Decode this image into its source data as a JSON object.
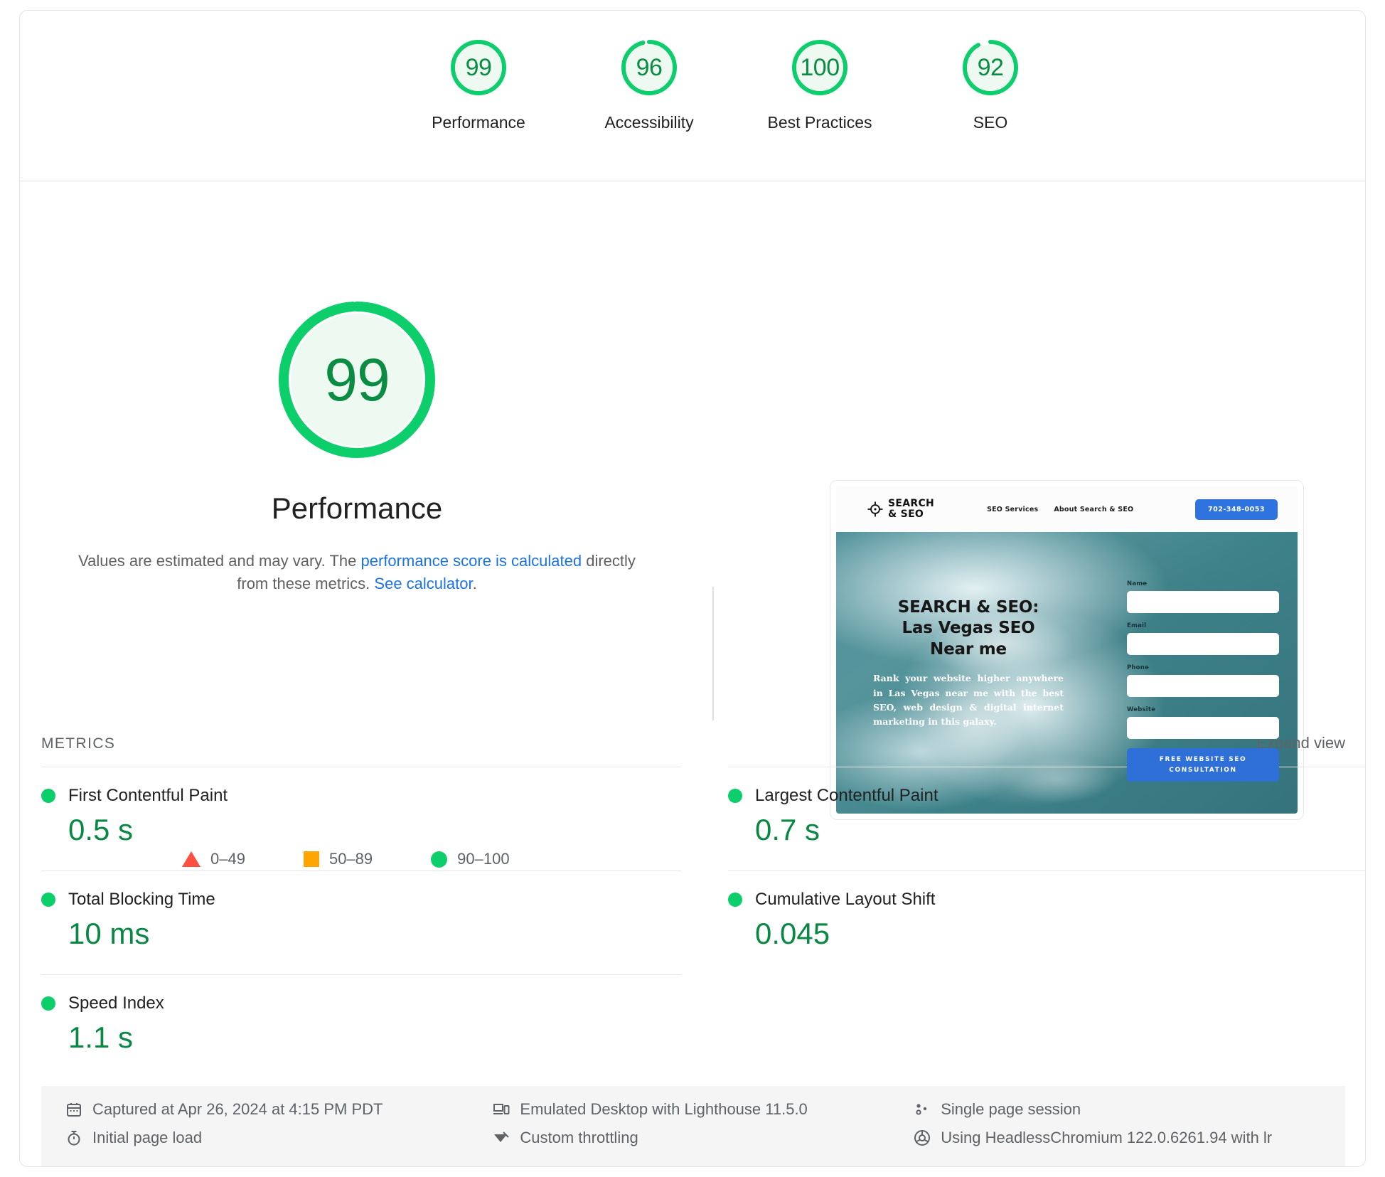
{
  "colors": {
    "green": "#0cce6b",
    "green_text": "#088842",
    "orange": "#ffa400",
    "red": "#ff4e42",
    "link": "#1a73e8",
    "gauge_fill": "#eef9f1"
  },
  "score_gauges": [
    {
      "score": 99,
      "label": "Performance"
    },
    {
      "score": 96,
      "label": "Accessibility"
    },
    {
      "score": 100,
      "label": "Best Practices"
    },
    {
      "score": 92,
      "label": "SEO"
    }
  ],
  "hero": {
    "score": 99,
    "title": "Performance",
    "desc_part1": "Values are estimated and may vary. The ",
    "desc_link1": "performance score is calculated",
    "desc_part2": " directly from these metrics. ",
    "desc_link2": "See calculator",
    "desc_part3": "."
  },
  "legend": [
    {
      "icon": "triangle-icon",
      "label": "0–49"
    },
    {
      "icon": "square-icon",
      "label": "50–89"
    },
    {
      "icon": "circle-icon",
      "label": "90–100"
    }
  ],
  "metrics_section": {
    "title": "METRICS",
    "expand_label": "Expand view",
    "left": [
      {
        "name": "First Contentful Paint",
        "value": "0.5 s",
        "status": "pass"
      },
      {
        "name": "Total Blocking Time",
        "value": "10 ms",
        "status": "pass"
      },
      {
        "name": "Speed Index",
        "value": "1.1 s",
        "status": "pass"
      }
    ],
    "right": [
      {
        "name": "Largest Contentful Paint",
        "value": "0.7 s",
        "status": "pass"
      },
      {
        "name": "Cumulative Layout Shift",
        "value": "0.045",
        "status": "pass"
      }
    ]
  },
  "thumbnail": {
    "logo_line1": "SEARCH",
    "logo_line2": "& SEO",
    "nav": [
      "SEO Services",
      "About Search & SEO"
    ],
    "phone": "702-348-0053",
    "headline_line1": "SEARCH & SEO:",
    "headline_line2": "Las Vegas SEO",
    "headline_line3": "Near me",
    "subtext": "Rank your website higher anywhere in Las Vegas near me with the best SEO, web design & digital internet marketing in this galaxy.",
    "form_labels": [
      "Name",
      "Email",
      "Phone",
      "Website"
    ],
    "cta_line1": "FREE WEBSITE SEO",
    "cta_line2": "CONSULTATION"
  },
  "footer": {
    "captured": "Captured at Apr 26, 2024 at 4:15 PM PDT",
    "page_load": "Initial page load",
    "emulation": "Emulated Desktop with Lighthouse 11.5.0",
    "throttling": "Custom throttling",
    "session": "Single page session",
    "chromium": "Using HeadlessChromium 122.0.6261.94 with lr"
  }
}
